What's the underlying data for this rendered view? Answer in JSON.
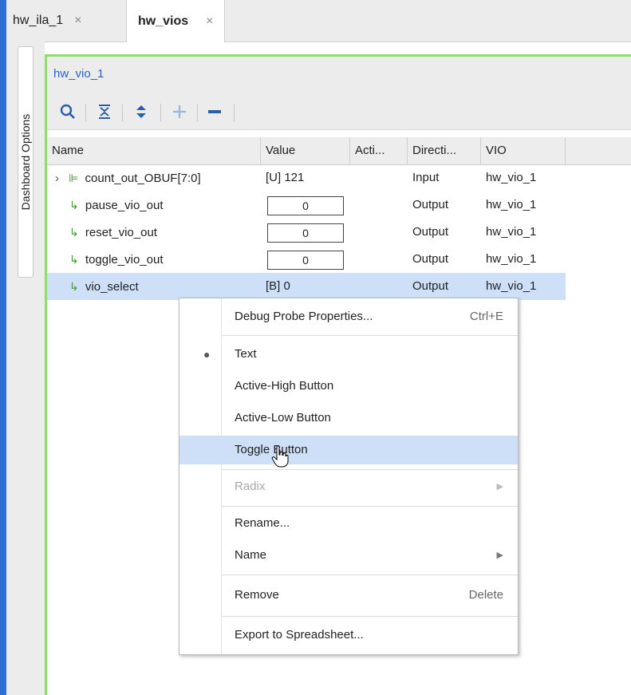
{
  "tabs": [
    {
      "label": "hw_ila_1",
      "close": "×"
    },
    {
      "label": "hw_vios",
      "close": "×"
    }
  ],
  "sidebar": {
    "dashboard_options": "Dashboard Options"
  },
  "panel": {
    "title": "hw_vio_1"
  },
  "columns": [
    "Name",
    "Value",
    "Acti...",
    "Directi...",
    "VIO"
  ],
  "rows": [
    {
      "name": "count_out_OBUF[7:0]",
      "value": "[U] 121",
      "direction": "Input",
      "vio": "hw_vio_1",
      "expandable": true
    },
    {
      "name": "pause_vio_out",
      "value": "0",
      "direction": "Output",
      "vio": "hw_vio_1"
    },
    {
      "name": "reset_vio_out",
      "value": "0",
      "direction": "Output",
      "vio": "hw_vio_1"
    },
    {
      "name": "toggle_vio_out",
      "value": "0",
      "direction": "Output",
      "vio": "hw_vio_1"
    },
    {
      "name": "vio_select",
      "value": "[B] 0",
      "direction": "Output",
      "vio": "hw_vio_1",
      "selected": true
    }
  ],
  "context_menu": {
    "items": [
      {
        "label": "Debug Probe Properties...",
        "shortcut": "Ctrl+E"
      },
      {
        "label": "Text",
        "checked": true
      },
      {
        "label": "Active-High Button"
      },
      {
        "label": "Active-Low Button"
      },
      {
        "label": "Toggle Button",
        "hovered": true
      },
      {
        "label": "Radix",
        "disabled": true,
        "submenu": true
      },
      {
        "label": "Rename..."
      },
      {
        "label": "Name",
        "submenu": true
      },
      {
        "label": "Remove",
        "shortcut": "Delete"
      },
      {
        "label": "Export to Spreadsheet..."
      }
    ]
  },
  "colors": {
    "accent_blue": "#2f6fd0",
    "panel_border": "#8ede6b",
    "selection": "#cde0f7"
  }
}
